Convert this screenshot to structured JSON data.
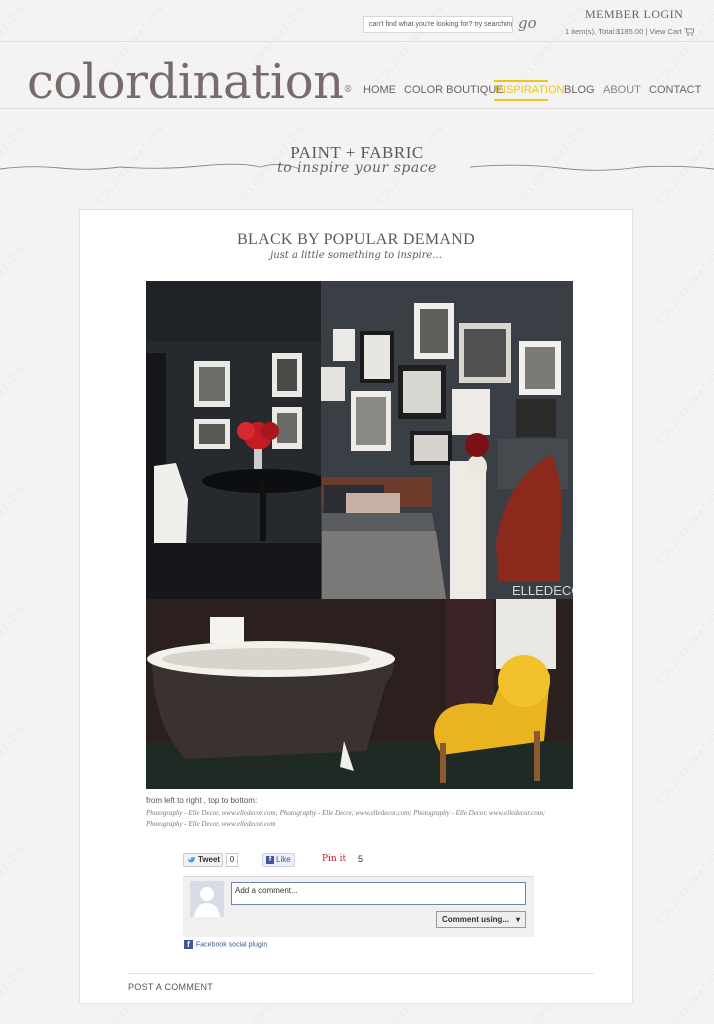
{
  "header": {
    "search_placeholder": "can't find what you're looking for? try searching!",
    "go_label": "go",
    "member_login": "MEMBER LOGIN",
    "cart_summary": "1 item(s), Total:$185.00 | View Cart"
  },
  "logo": {
    "text": "colordination",
    "mark": "®"
  },
  "nav": {
    "items": [
      {
        "label": "HOME"
      },
      {
        "label": "COLOR BOUTIQUE"
      },
      {
        "label": "INSPIRATION"
      },
      {
        "label": "BLOG"
      },
      {
        "label": "ABOUT"
      },
      {
        "label": "CONTACT"
      }
    ],
    "active_index": 2,
    "active_color": "#f0c419"
  },
  "tagline": {
    "title": "PAINT + FABRIC",
    "subtitle": "to inspire your space"
  },
  "watermark_text": "COLORDINATION",
  "post": {
    "title": "BLACK BY POPULAR DEMAND",
    "subtitle": "just a little something to inspire...",
    "image_watermark": "ELLEDECOR",
    "credit_heading": "from left to right , top to bottom:",
    "credit_text": "Photography - Elle Decor, www.elledecor.com; Photography - Elle Decor, www.elledecor.com; Photography - Elle Decor, www.elledecor.com; Photography - Elle Decor, www.elledecor.com"
  },
  "social": {
    "tweet_label": "Tweet",
    "tweet_count": "0",
    "like_label": "Like",
    "pin_label": "Pin it",
    "pin_count": "5"
  },
  "facebook": {
    "comment_placeholder": "Add a comment...",
    "comment_using": "Comment using...",
    "plugin_label": "Facebook social plugin"
  },
  "footer": {
    "post_comment": "POST A COMMENT"
  }
}
